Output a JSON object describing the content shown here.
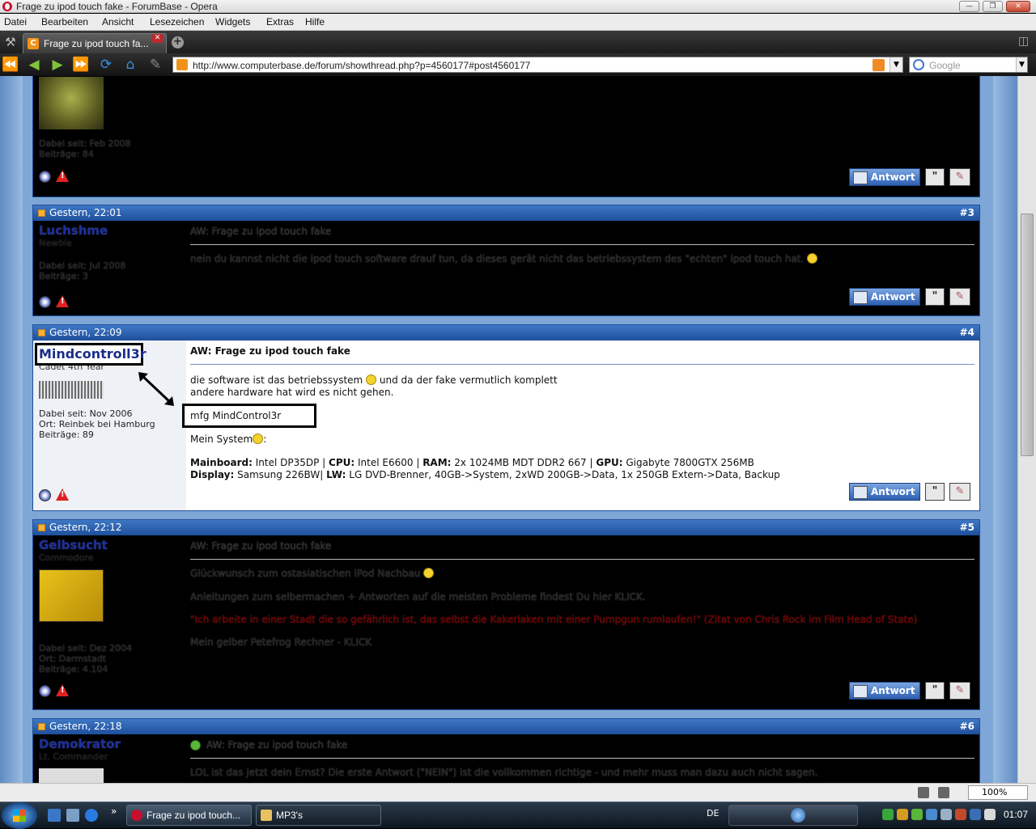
{
  "window": {
    "title": "Frage zu ipod touch fake - ForumBase - Opera"
  },
  "menu": [
    "Datei",
    "Bearbeiten",
    "Ansicht",
    "Lesezeichen",
    "Widgets",
    "Extras",
    "Hilfe"
  ],
  "tab": {
    "label": "Frage zu ipod touch fa..."
  },
  "address": {
    "url": "http://www.computerbase.de/forum/showthread.php?p=4560177#post4560177",
    "search_placeholder": "Google"
  },
  "posts": [
    {
      "variant": "dark",
      "info": [
        "Dabei seit: Feb 2008",
        "Beiträge: 84"
      ],
      "reply_label": "Antwort"
    },
    {
      "variant": "dark",
      "date": "Gestern, 22:01",
      "number": "#3",
      "username": "Luchshme",
      "rank": "Newbie",
      "info": [
        "Dabei seit: Jul 2008",
        "Beiträge: 3"
      ],
      "title": "AW: Frage zu ipod touch fake",
      "lines": [
        "nein du kannst nicht die ipod touch software drauf tun, da dieses gerät nicht das betriebssystem des \"echten\" ipod touch hat."
      ],
      "reply_label": "Antwort"
    },
    {
      "variant": "light",
      "date": "Gestern, 22:09",
      "number": "#4",
      "username": "Mindcontroll3r",
      "rank": "Cadet 4th Year",
      "info": [
        "Dabei seit: Nov 2006",
        "Ort: Reinbek bei Hamburg",
        "Beiträge: 89"
      ],
      "title": "AW: Frage zu ipod touch fake",
      "line1a": "die software ist das betriebssystem",
      "line1b": "und da der fake vermutlich komplett",
      "line2": "andere hardware hat wird es nicht gehen.",
      "signature": "mfg MindControl3r",
      "system_label": "Mein System",
      "spec1": [
        {
          "k": "Mainboard:",
          "v": " Intel DP35DP | "
        },
        {
          "k": "CPU:",
          "v": " Intel E6600 | "
        },
        {
          "k": "RAM:",
          "v": " 2x 1024MB MDT DDR2 667 | "
        },
        {
          "k": "GPU:",
          "v": " Gigabyte 7800GTX 256MB"
        }
      ],
      "spec2": [
        {
          "k": "Display:",
          "v": " Samsung 226BW| "
        },
        {
          "k": "LW:",
          "v": " LG DVD-Brenner, 40GB->System, 2xWD 200GB->Data, 1x 250GB Extern->Data, Backup"
        }
      ],
      "reply_label": "Antwort"
    },
    {
      "variant": "dark",
      "date": "Gestern, 22:12",
      "number": "#5",
      "username": "Gelbsucht",
      "rank": "Commodore",
      "info": [
        "Dabei seit: Dez 2004",
        "Ort: Darmstadt",
        "Beiträge: 4.104"
      ],
      "title": "AW: Frage zu ipod touch fake",
      "l1": "Glückwunsch zum ostasiatischen iPod Nachbau",
      "l2": "Anleitungen zum selbermachen + Antworten auf die meisten Probleme findest Du hier KLICK.",
      "l3": "\"Ich arbeite in einer Stadt die so gefährlich ist, das selbst die Kakerlaken mit einer Pumpgun rumlaufen!\" (Zitat von Chris Rock im Film Head of State)",
      "l4": "Mein gelber Petefrog Rechner - KLICK",
      "reply_label": "Antwort"
    },
    {
      "variant": "dark",
      "date": "Gestern, 22:18",
      "number": "#6",
      "username": "Demokrator",
      "rank": "Lt. Commander",
      "title": "AW: Frage zu ipod touch fake",
      "l1": "LOL  ist das jetzt dein Ernst? Die erste Antwort (\"NEIN\") ist die vollkommen richtige - und mehr muss man dazu auch nicht sagen."
    }
  ],
  "status": {
    "zoom": "100%"
  },
  "taskbar": {
    "task1": "Frage zu ipod touch...",
    "task2": "MP3's",
    "lang": "DE",
    "clock": "01:07"
  },
  "colors": {
    "header_blue": "#2a5fae",
    "page_bg": "#7ea6d6",
    "username_blue": "#1a2c8a"
  }
}
